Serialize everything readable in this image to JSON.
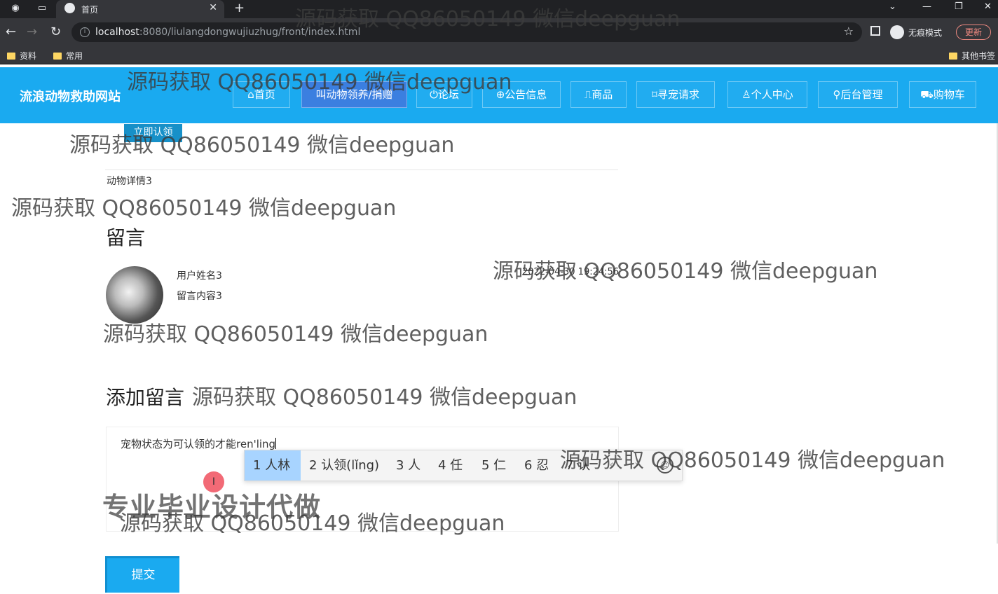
{
  "browser": {
    "tab_title": "首页",
    "url_host": "localhost",
    "url_rest": ":8080/liulangdongwujiuzhug/front/index.html",
    "incognito_label": "无痕模式",
    "update_label": "更新",
    "bookmarks": [
      "资料",
      "常用",
      "其他书签"
    ]
  },
  "site": {
    "title": "流浪动物救助网站",
    "nav": [
      {
        "label": "⌂首页",
        "icon": "home-icon"
      },
      {
        "label": "叫动物领养/捐赠",
        "icon": "pet-icon"
      },
      {
        "label": "⏻论坛",
        "icon": "power-icon"
      },
      {
        "label": "⊕公告信息",
        "icon": "globe-icon"
      },
      {
        "label": "⎍商品",
        "icon": "book-icon"
      },
      {
        "label": "⌑寻宠请求",
        "icon": "tag-icon"
      },
      {
        "label": "♙个人中心",
        "icon": "user-icon"
      },
      {
        "label": "⚲后台管理",
        "icon": "link-icon"
      },
      {
        "label": "⛟购物车",
        "icon": "cart-icon"
      }
    ],
    "active_nav_index": 1
  },
  "page": {
    "apply_button": "立即认领",
    "detail_text": "动物详情3",
    "messages_heading": "留言",
    "message": {
      "user": "用户姓名3",
      "content": "留言内容3",
      "time": "2022-04-30 19:24:56"
    },
    "add_heading": "添加留言",
    "textarea_value": "宠物状态为可认领的才能ren'ling",
    "submit_label": "提交"
  },
  "ime": {
    "candidates": [
      "1 人林",
      "2 认领(lǐng)",
      "3 人",
      "4 任",
      "5 仁",
      "6 忍",
      "7 认"
    ],
    "selected_index": 0,
    "prev_icon": "‹",
    "next_icon": "›",
    "emoji_icon": "☺"
  },
  "overlay": {
    "watermark": "源码获取 QQ86050149 微信deepguan",
    "promo": "专业毕业设计代做",
    "cursor_glyph": "I"
  },
  "colors": {
    "nav_bg": "#1aaaf0",
    "nav_active": "#3b7fe0",
    "ime_selected": "#a8d4ff"
  }
}
